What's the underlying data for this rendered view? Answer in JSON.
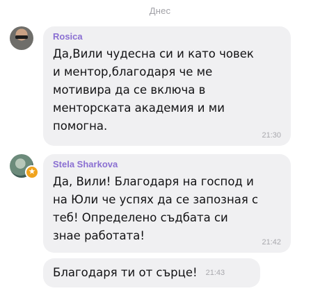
{
  "chat": {
    "date_divider": "Днес",
    "messages": [
      {
        "sender": "Rosica",
        "text": "Да,Вили чудесна си и като човек\nи ментор,благодаря че ме\nмотивира да се включа в\nменторската академия и ми\nпомогна.",
        "time": "21:30"
      },
      {
        "sender": "Stela Sharkova",
        "text": "Да, Вили! Благодаря на господ и\nна Юли че успях да се запозная с\nтеб!  Определено съдбата си\nзнае работата!",
        "time": "21:42"
      },
      {
        "text": "Благодаря ти от сърце!",
        "time": "21:43"
      }
    ]
  }
}
